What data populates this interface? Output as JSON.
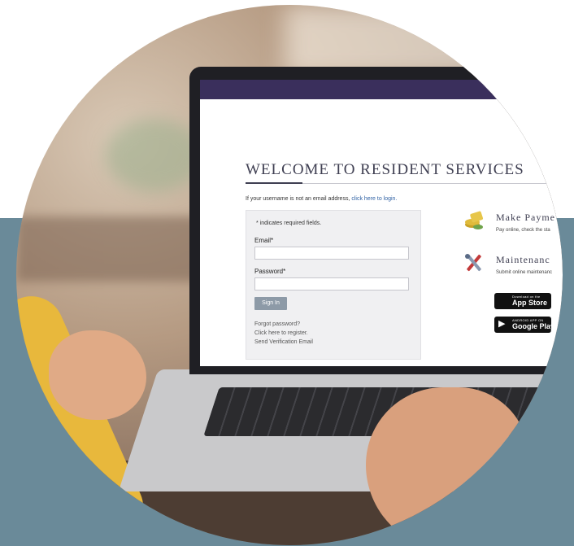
{
  "page": {
    "title": "WELCOME TO RESIDENT SERVICES",
    "username_note": "If your username is not an email address,",
    "username_link": "click here to login."
  },
  "login": {
    "required_note": "* indicates required fields.",
    "email_label": "Email*",
    "email_value": "",
    "password_label": "Password*",
    "password_value": "",
    "sign_in_label": "Sign In",
    "forgot_password": "Forgot password?",
    "register": "Click here to register.",
    "send_verification": "Send Verification Email"
  },
  "features": [
    {
      "title": "Make Payme",
      "description": "Pay online, check the sta",
      "icon": "coins-icon"
    },
    {
      "title": "Maintenanc",
      "description": "Submit online maintenanc",
      "icon": "tools-icon"
    }
  ],
  "stores": [
    {
      "small": "Download on the",
      "big": "App Store",
      "icon": "apple-icon"
    },
    {
      "small": "ANDROID APP ON",
      "big": "Google Play",
      "icon": "play-icon"
    }
  ],
  "colors": {
    "header": "#3a2f5c",
    "slate_block": "#6a8a99",
    "link": "#2f61a4",
    "button": "#8d9aa7"
  }
}
